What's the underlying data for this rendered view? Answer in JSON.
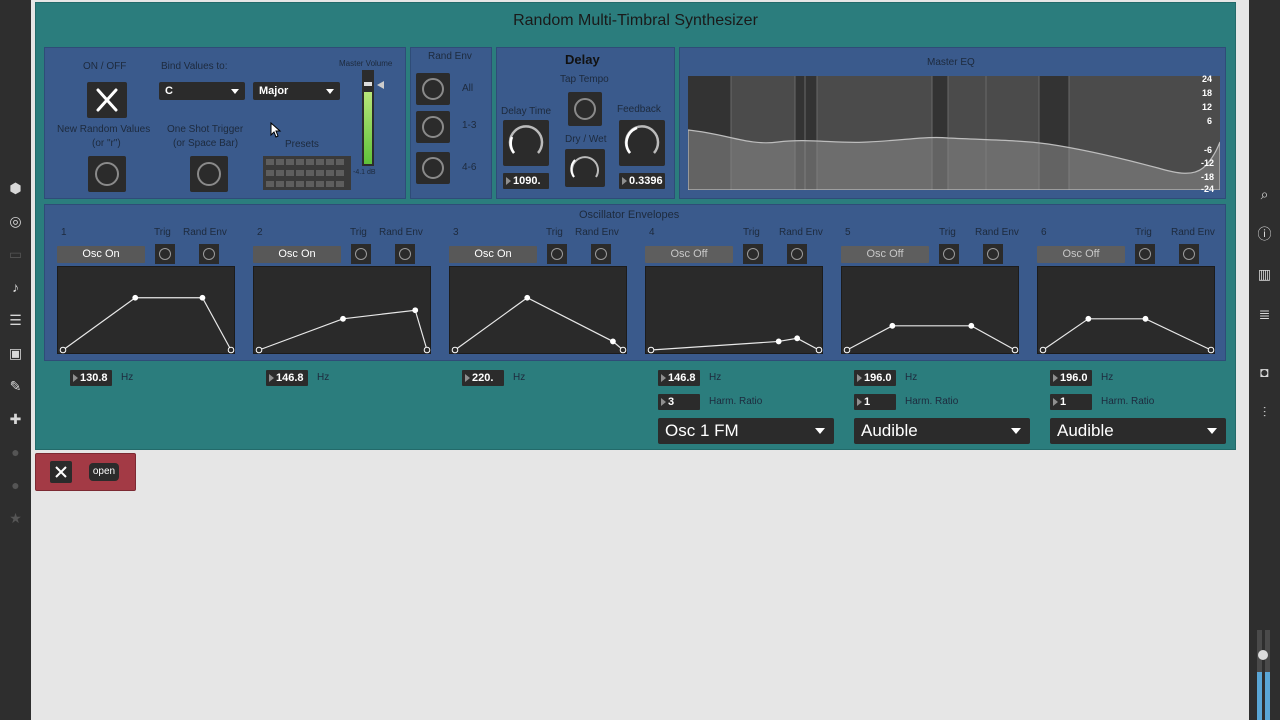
{
  "patch": {
    "title": "Random Multi-Timbral Synthesizer",
    "global": {
      "onoff_label": "ON / OFF",
      "bind_label": "Bind Values to:",
      "key_value": "C",
      "scale_value": "Major",
      "random_label_1": "New Random Values",
      "random_label_2": "(or \"r\")",
      "trigger_label_1": "One Shot Trigger",
      "trigger_label_2": "(or Space Bar)",
      "presets_label": "Presets",
      "master_volume_label": "Master Volume",
      "master_volume_db": "-4.1 dB"
    },
    "rand_env": {
      "title": "Rand Env",
      "rows": [
        "All",
        "1-3",
        "4-6"
      ]
    },
    "delay": {
      "title": "Delay",
      "tap_tempo": "Tap Tempo",
      "delay_time_label": "Delay Time",
      "dry_wet_label": "Dry / Wet",
      "feedback_label": "Feedback",
      "delay_time_value": "1090.",
      "feedback_value": "0.3396"
    },
    "eq": {
      "title": "Master EQ",
      "scale": [
        "24",
        "18",
        "12",
        "6",
        "-6",
        "-12",
        "-18",
        "-24"
      ]
    },
    "oscillators": {
      "title": "Oscillator Envelopes",
      "trig_label": "Trig",
      "randenv_label": "Rand Env",
      "hz_label": "Hz",
      "harm_label": "Harm. Ratio",
      "items": [
        {
          "index": "1",
          "toggle": "Osc On",
          "on": true,
          "freq": "130.8",
          "env": [
            [
              0,
              1
            ],
            [
              0.43,
              0.33
            ],
            [
              0.83,
              0.33
            ],
            [
              1,
              1
            ]
          ]
        },
        {
          "index": "2",
          "toggle": "Osc On",
          "on": true,
          "freq": "146.8",
          "env": [
            [
              0,
              1
            ],
            [
              0.5,
              0.6
            ],
            [
              0.93,
              0.49
            ],
            [
              1,
              1
            ]
          ]
        },
        {
          "index": "3",
          "toggle": "Osc On",
          "on": true,
          "freq": "220.",
          "env": [
            [
              0,
              1
            ],
            [
              0.43,
              0.33
            ],
            [
              0.94,
              0.89
            ],
            [
              1,
              1
            ]
          ]
        },
        {
          "index": "4",
          "toggle": "Osc Off",
          "on": false,
          "freq": "146.8",
          "harm": "3",
          "mode": "Osc 1 FM",
          "env": [
            [
              0,
              1
            ],
            [
              0.76,
              0.89
            ],
            [
              0.87,
              0.85
            ],
            [
              1,
              1
            ]
          ]
        },
        {
          "index": "5",
          "toggle": "Osc Off",
          "on": false,
          "freq": "196.0",
          "harm": "1",
          "mode": "Audible",
          "env": [
            [
              0,
              1
            ],
            [
              0.27,
              0.69
            ],
            [
              0.74,
              0.69
            ],
            [
              1,
              1
            ]
          ]
        },
        {
          "index": "6",
          "toggle": "Osc Off",
          "on": false,
          "freq": "196.0",
          "harm": "1",
          "mode": "Audible",
          "env": [
            [
              0,
              1
            ],
            [
              0.27,
              0.6
            ],
            [
              0.61,
              0.6
            ],
            [
              1,
              1
            ]
          ]
        }
      ]
    }
  },
  "close_box": {
    "open_label": "open"
  }
}
